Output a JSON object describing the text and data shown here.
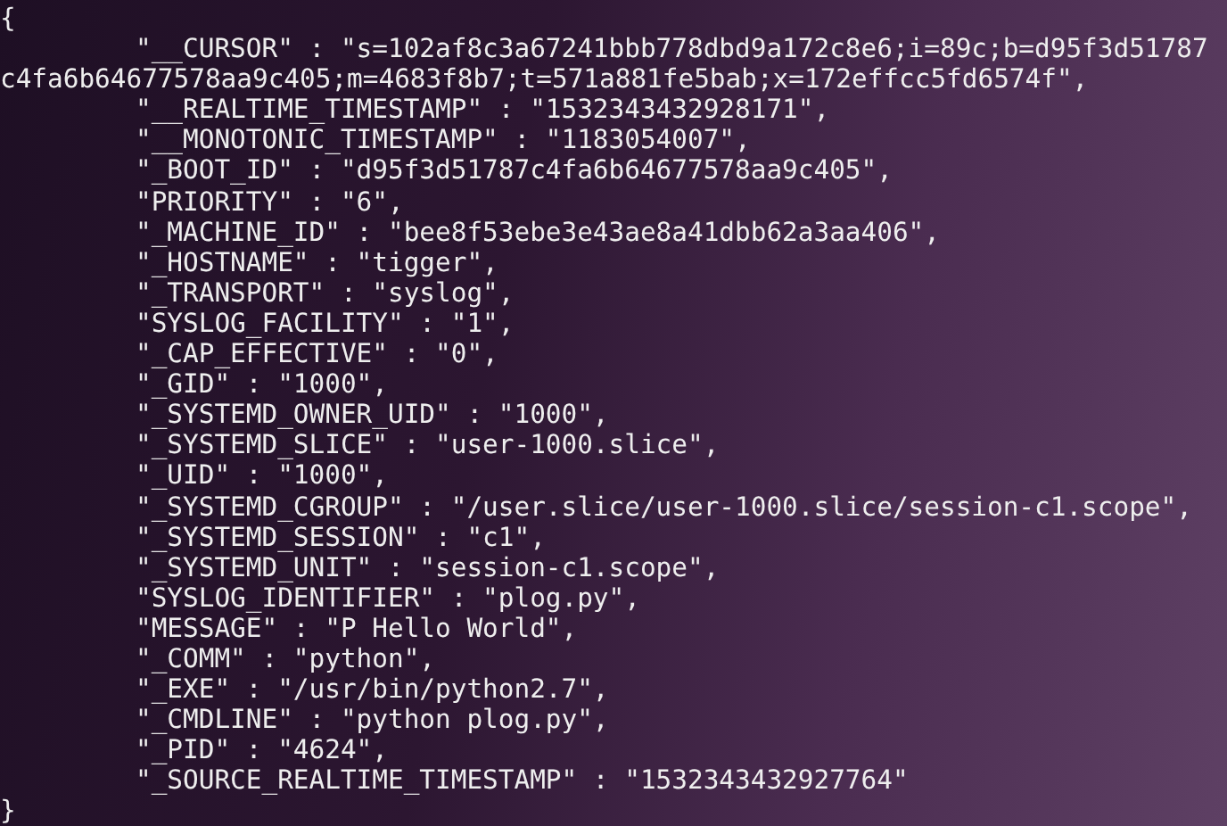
{
  "terminal": {
    "lines": [
      {
        "kind": "brace",
        "text": "{"
      },
      {
        "kind": "field",
        "text": "\"__CURSOR\" : \"s=102af8c3a67241bbb778dbd9a172c8e6;i=89c;b=d95f3d51787c4fa6b64677578aa9c405;m=4683f8b7;t=571a881fe5bab;x=172effcc5fd6574f\","
      },
      {
        "kind": "field",
        "text": "\"__REALTIME_TIMESTAMP\" : \"1532343432928171\","
      },
      {
        "kind": "field",
        "text": "\"__MONOTONIC_TIMESTAMP\" : \"1183054007\","
      },
      {
        "kind": "field",
        "text": "\"_BOOT_ID\" : \"d95f3d51787c4fa6b64677578aa9c405\","
      },
      {
        "kind": "field",
        "text": "\"PRIORITY\" : \"6\","
      },
      {
        "kind": "field",
        "text": "\"_MACHINE_ID\" : \"bee8f53ebe3e43ae8a41dbb62a3aa406\","
      },
      {
        "kind": "field",
        "text": "\"_HOSTNAME\" : \"tigger\","
      },
      {
        "kind": "field",
        "text": "\"_TRANSPORT\" : \"syslog\","
      },
      {
        "kind": "field",
        "text": "\"SYSLOG_FACILITY\" : \"1\","
      },
      {
        "kind": "field",
        "text": "\"_CAP_EFFECTIVE\" : \"0\","
      },
      {
        "kind": "field",
        "text": "\"_GID\" : \"1000\","
      },
      {
        "kind": "field",
        "text": "\"_SYSTEMD_OWNER_UID\" : \"1000\","
      },
      {
        "kind": "field",
        "text": "\"_SYSTEMD_SLICE\" : \"user-1000.slice\","
      },
      {
        "kind": "field",
        "text": "\"_UID\" : \"1000\","
      },
      {
        "kind": "field",
        "text": "\"_SYSTEMD_CGROUP\" : \"/user.slice/user-1000.slice/session-c1.scope\","
      },
      {
        "kind": "field",
        "text": "\"_SYSTEMD_SESSION\" : \"c1\","
      },
      {
        "kind": "field",
        "text": "\"_SYSTEMD_UNIT\" : \"session-c1.scope\","
      },
      {
        "kind": "field",
        "text": "\"SYSLOG_IDENTIFIER\" : \"plog.py\","
      },
      {
        "kind": "field",
        "text": "\"MESSAGE\" : \"P Hello World\","
      },
      {
        "kind": "field",
        "text": "\"_COMM\" : \"python\","
      },
      {
        "kind": "field",
        "text": "\"_EXE\" : \"/usr/bin/python2.7\","
      },
      {
        "kind": "field",
        "text": "\"_CMDLINE\" : \"python plog.py\","
      },
      {
        "kind": "field",
        "text": "\"_PID\" : \"4624\","
      },
      {
        "kind": "field",
        "text": "\"_SOURCE_REALTIME_TIMESTAMP\" : \"1532343432927764\""
      },
      {
        "kind": "brace",
        "text": "}"
      }
    ]
  }
}
